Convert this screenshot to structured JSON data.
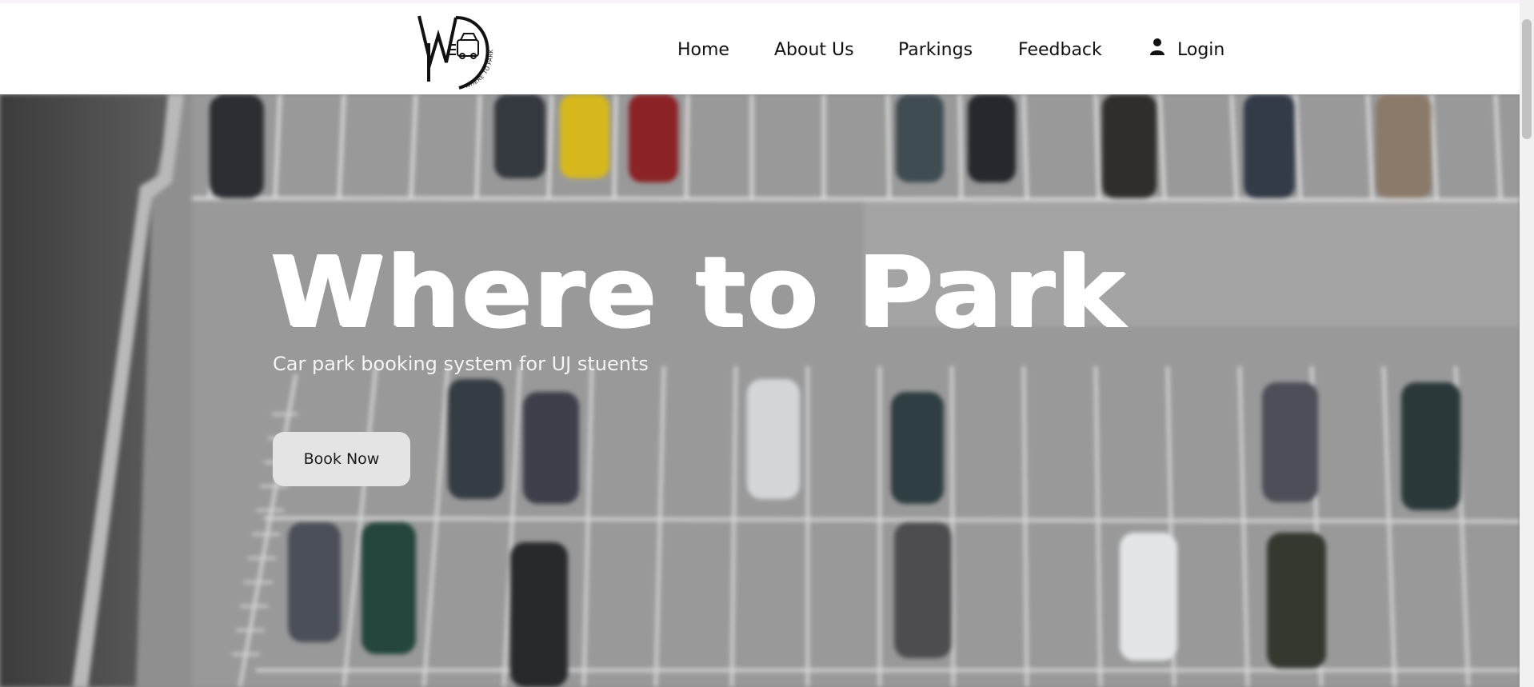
{
  "brand": {
    "logo_letters": "WP",
    "logo_text": "WHERE TO PARK"
  },
  "nav": {
    "home": "Home",
    "about": "About Us",
    "parkings": "Parkings",
    "feedback": "Feedback",
    "login": "Login",
    "login_icon": "user-icon"
  },
  "hero": {
    "title": "Where to Park",
    "subtitle": "Car park booking system for UJ stuents",
    "cta_label": "Book Now",
    "background": "blurred aerial view of a car park"
  },
  "colors": {
    "header_bg": "#ffffff",
    "nav_text": "#111111",
    "hero_text": "#ffffff",
    "button_bg": "#e4e4e4"
  }
}
